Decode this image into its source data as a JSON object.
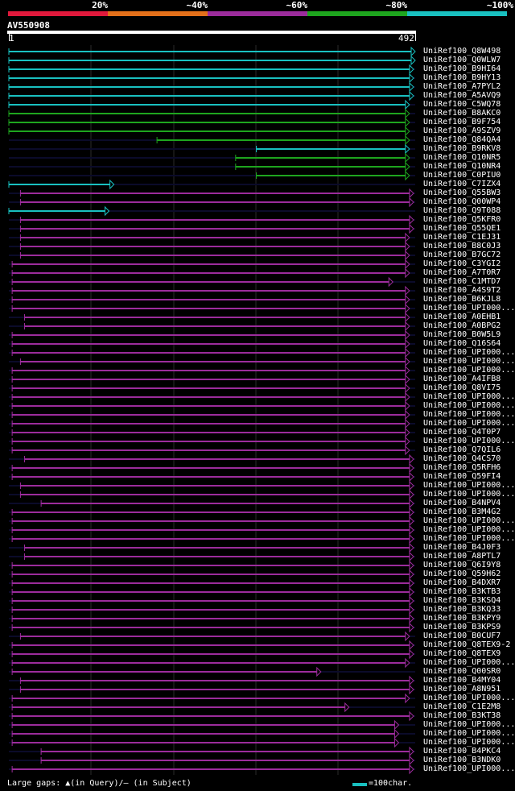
{
  "legend": {
    "ticks": [
      "20%",
      "~40%",
      "~60%",
      "~80%",
      "~100%"
    ],
    "colors": [
      "#e0193c",
      "#e3701a",
      "#9c2c9c",
      "#1ea51e",
      "#19c0c0"
    ]
  },
  "query": {
    "title": "AV550908",
    "start": "1",
    "end": "492",
    "length": 492
  },
  "footer": {
    "gaps_note": "Large gaps: ▲(in Query)/— (in Subject)",
    "scale_note": "=100char."
  },
  "diagram_data": {
    "hits": [
      {
        "name": "UniRef100_Q8W498",
        "identity": "100",
        "qstart": 1,
        "qend": 492,
        "arrow": true
      },
      {
        "name": "UniRef100_Q0WLW7",
        "identity": "100",
        "qstart": 1,
        "qend": 492,
        "arrow": true
      },
      {
        "name": "UniRef100_B9HI64",
        "identity": "100",
        "qstart": 1,
        "qend": 490,
        "arrow": true
      },
      {
        "name": "UniRef100_B9HY13",
        "identity": "100",
        "qstart": 1,
        "qend": 490,
        "arrow": true
      },
      {
        "name": "UniRef100_A7PYL2",
        "identity": "100",
        "qstart": 1,
        "qend": 490,
        "arrow": true
      },
      {
        "name": "UniRef100_A5AVQ9",
        "identity": "100",
        "qstart": 1,
        "qend": 490,
        "arrow": true
      },
      {
        "name": "UniRef100_C5WQ78",
        "identity": "100",
        "qstart": 1,
        "qend": 485,
        "arrow": true
      },
      {
        "name": "UniRef100_B8AKC0",
        "identity": "80",
        "qstart": 1,
        "qend": 485,
        "arrow": true
      },
      {
        "name": "UniRef100_B9F754",
        "identity": "80",
        "qstart": 1,
        "qend": 485,
        "arrow": true
      },
      {
        "name": "UniRef100_A9SZV9",
        "identity": "80",
        "qstart": 1,
        "qend": 485,
        "arrow": true
      },
      {
        "name": "UniRef100_Q84QA4",
        "identity": "80",
        "qstart": 180,
        "qend": 485,
        "arrow": true
      },
      {
        "name": "UniRef100_B9RKV8",
        "identity": "100",
        "qstart": 300,
        "qend": 485,
        "arrow": true
      },
      {
        "name": "UniRef100_Q10NR5",
        "identity": "80",
        "qstart": 275,
        "qend": 485,
        "arrow": true
      },
      {
        "name": "UniRef100_Q10NR4",
        "identity": "80",
        "qstart": 275,
        "qend": 485,
        "arrow": true
      },
      {
        "name": "UniRef100_C0PIU0",
        "identity": "80",
        "qstart": 300,
        "qend": 485,
        "arrow": true
      },
      {
        "name": "UniRef100_C7IZX4",
        "identity": "100",
        "qstart": 1,
        "qend": 128,
        "arrow": true
      },
      {
        "name": "UniRef100_Q55BW3",
        "identity": "60",
        "qstart": 15,
        "qend": 490,
        "arrow": true
      },
      {
        "name": "UniRef100_Q00WP4",
        "identity": "60",
        "qstart": 15,
        "qend": 490,
        "arrow": true
      },
      {
        "name": "UniRef100_Q9T088",
        "identity": "100",
        "qstart": 1,
        "qend": 122,
        "arrow": true
      },
      {
        "name": "UniRef100_Q5KFR0",
        "identity": "60",
        "qstart": 15,
        "qend": 490,
        "arrow": true
      },
      {
        "name": "UniRef100_Q55QE1",
        "identity": "60",
        "qstart": 15,
        "qend": 490,
        "arrow": true
      },
      {
        "name": "UniRef100_C1EJ31",
        "identity": "60",
        "qstart": 15,
        "qend": 485,
        "arrow": true
      },
      {
        "name": "UniRef100_B8C0J3",
        "identity": "60",
        "qstart": 15,
        "qend": 485,
        "arrow": true
      },
      {
        "name": "UniRef100_B7GC72",
        "identity": "60",
        "qstart": 15,
        "qend": 485,
        "arrow": true
      },
      {
        "name": "UniRef100_C3YGI2",
        "identity": "60",
        "qstart": 5,
        "qend": 485,
        "arrow": true
      },
      {
        "name": "UniRef100_A7T0R7",
        "identity": "60",
        "qstart": 5,
        "qend": 485,
        "arrow": true
      },
      {
        "name": "UniRef100_C1MTD7",
        "identity": "60",
        "qstart": 5,
        "qend": 465,
        "arrow": true
      },
      {
        "name": "UniRef100_A4S9T2",
        "identity": "60",
        "qstart": 5,
        "qend": 485,
        "arrow": true
      },
      {
        "name": "UniRef100_B6KJL8",
        "identity": "60",
        "qstart": 5,
        "qend": 485,
        "arrow": true
      },
      {
        "name": "UniRef100_UPI000...",
        "identity": "60",
        "qstart": 5,
        "qend": 485,
        "arrow": true
      },
      {
        "name": "UniRef100_A0EHB1",
        "identity": "60",
        "qstart": 20,
        "qend": 485,
        "arrow": true
      },
      {
        "name": "UniRef100_A0BPG2",
        "identity": "60",
        "qstart": 20,
        "qend": 485,
        "arrow": true
      },
      {
        "name": "UniRef100_B0W5L9",
        "identity": "60",
        "qstart": 5,
        "qend": 485,
        "arrow": true
      },
      {
        "name": "UniRef100_Q16S64",
        "identity": "60",
        "qstart": 5,
        "qend": 485,
        "arrow": true
      },
      {
        "name": "UniRef100_UPI000...",
        "identity": "60",
        "qstart": 5,
        "qend": 485,
        "arrow": true
      },
      {
        "name": "UniRef100_UPI000...",
        "identity": "60",
        "qstart": 15,
        "qend": 485,
        "arrow": true
      },
      {
        "name": "UniRef100_UPI000...",
        "identity": "60",
        "qstart": 5,
        "qend": 485,
        "arrow": true
      },
      {
        "name": "UniRef100_A4IFB8",
        "identity": "60",
        "qstart": 5,
        "qend": 485,
        "arrow": true
      },
      {
        "name": "UniRef100_Q8VI75",
        "identity": "60",
        "qstart": 5,
        "qend": 485,
        "arrow": true
      },
      {
        "name": "UniRef100_UPI000...",
        "identity": "60",
        "qstart": 5,
        "qend": 485,
        "arrow": true
      },
      {
        "name": "UniRef100_UPI000...",
        "identity": "60",
        "qstart": 5,
        "qend": 485,
        "arrow": true
      },
      {
        "name": "UniRef100_UPI000...",
        "identity": "60",
        "qstart": 5,
        "qend": 485,
        "arrow": true
      },
      {
        "name": "UniRef100_UPI000...",
        "identity": "60",
        "qstart": 5,
        "qend": 485,
        "arrow": true
      },
      {
        "name": "UniRef100_Q4T0P7",
        "identity": "60",
        "qstart": 5,
        "qend": 485,
        "arrow": true
      },
      {
        "name": "UniRef100_UPI000...",
        "identity": "60",
        "qstart": 5,
        "qend": 485,
        "arrow": true
      },
      {
        "name": "UniRef100_Q7QIL6",
        "identity": "60",
        "qstart": 5,
        "qend": 485,
        "arrow": true
      },
      {
        "name": "UniRef100_Q4CS70",
        "identity": "60",
        "qstart": 20,
        "qend": 490,
        "arrow": true
      },
      {
        "name": "UniRef100_Q5RFH6",
        "identity": "60",
        "qstart": 5,
        "qend": 490,
        "arrow": true
      },
      {
        "name": "UniRef100_Q59FI4",
        "identity": "60",
        "qstart": 5,
        "qend": 490,
        "arrow": true
      },
      {
        "name": "UniRef100_UPI000...",
        "identity": "60",
        "qstart": 15,
        "qend": 490,
        "arrow": true
      },
      {
        "name": "UniRef100_UPI000...",
        "identity": "60",
        "qstart": 15,
        "qend": 490,
        "arrow": true
      },
      {
        "name": "UniRef100_B4NPV4",
        "identity": "60",
        "qstart": 40,
        "qend": 490,
        "arrow": true
      },
      {
        "name": "UniRef100_B3M4G2",
        "identity": "60",
        "qstart": 5,
        "qend": 490,
        "arrow": true
      },
      {
        "name": "UniRef100_UPI000...",
        "identity": "60",
        "qstart": 5,
        "qend": 490,
        "arrow": true
      },
      {
        "name": "UniRef100_UPI000...",
        "identity": "60",
        "qstart": 5,
        "qend": 490,
        "arrow": true
      },
      {
        "name": "UniRef100_UPI000...",
        "identity": "60",
        "qstart": 5,
        "qend": 490,
        "arrow": true
      },
      {
        "name": "UniRef100_B4J0F3",
        "identity": "60",
        "qstart": 20,
        "qend": 490,
        "arrow": true
      },
      {
        "name": "UniRef100_A8PTL7",
        "identity": "60",
        "qstart": 20,
        "qend": 490,
        "arrow": true
      },
      {
        "name": "UniRef100_Q6I9Y8",
        "identity": "60",
        "qstart": 5,
        "qend": 490,
        "arrow": true
      },
      {
        "name": "UniRef100_Q59H62",
        "identity": "60",
        "qstart": 5,
        "qend": 490,
        "arrow": true
      },
      {
        "name": "UniRef100_B4DXR7",
        "identity": "60",
        "qstart": 5,
        "qend": 490,
        "arrow": true
      },
      {
        "name": "UniRef100_B3KTB3",
        "identity": "60",
        "qstart": 5,
        "qend": 490,
        "arrow": true
      },
      {
        "name": "UniRef100_B3KSQ4",
        "identity": "60",
        "qstart": 5,
        "qend": 490,
        "arrow": true
      },
      {
        "name": "UniRef100_B3KQ33",
        "identity": "60",
        "qstart": 5,
        "qend": 490,
        "arrow": true
      },
      {
        "name": "UniRef100_B3KPY9",
        "identity": "60",
        "qstart": 5,
        "qend": 490,
        "arrow": true
      },
      {
        "name": "UniRef100_B3KPS9",
        "identity": "60",
        "qstart": 5,
        "qend": 490,
        "arrow": true
      },
      {
        "name": "UniRef100_B0CUF7",
        "identity": "60",
        "qstart": 15,
        "qend": 485,
        "arrow": true
      },
      {
        "name": "UniRef100_Q8TEX9-2",
        "identity": "60",
        "qstart": 5,
        "qend": 490,
        "arrow": true
      },
      {
        "name": "UniRef100_Q8TEX9",
        "identity": "60",
        "qstart": 5,
        "qend": 490,
        "arrow": true
      },
      {
        "name": "UniRef100_UPI000...",
        "identity": "60",
        "qstart": 5,
        "qend": 485,
        "arrow": true
      },
      {
        "name": "UniRef100_Q00SR0",
        "identity": "60",
        "qstart": 5,
        "qend": 378,
        "arrow": true
      },
      {
        "name": "UniRef100_B4MY04",
        "identity": "60",
        "qstart": 15,
        "qend": 490,
        "arrow": true
      },
      {
        "name": "UniRef100_A8N951",
        "identity": "60",
        "qstart": 15,
        "qend": 490,
        "arrow": true
      },
      {
        "name": "UniRef100_UPI000...",
        "identity": "60",
        "qstart": 5,
        "qend": 485,
        "arrow": true
      },
      {
        "name": "UniRef100_C1E2M8",
        "identity": "60",
        "qstart": 5,
        "qend": 412,
        "arrow": true
      },
      {
        "name": "UniRef100_B3KT38",
        "identity": "60",
        "qstart": 5,
        "qend": 490,
        "arrow": true
      },
      {
        "name": "UniRef100_UPI000...",
        "identity": "60",
        "qstart": 5,
        "qend": 472,
        "arrow": true
      },
      {
        "name": "UniRef100_UPI000...",
        "identity": "60",
        "qstart": 5,
        "qend": 472,
        "arrow": true
      },
      {
        "name": "UniRef100_UPI000...",
        "identity": "60",
        "qstart": 5,
        "qend": 472,
        "arrow": true
      },
      {
        "name": "UniRef100_B4PKC4",
        "identity": "60",
        "qstart": 40,
        "qend": 490,
        "arrow": true
      },
      {
        "name": "UniRef100_B3NDK0",
        "identity": "60",
        "qstart": 40,
        "qend": 490,
        "arrow": true
      },
      {
        "name": "UniRef100_UPI000...",
        "identity": "60",
        "qstart": 5,
        "qend": 490,
        "arrow": true
      }
    ]
  }
}
